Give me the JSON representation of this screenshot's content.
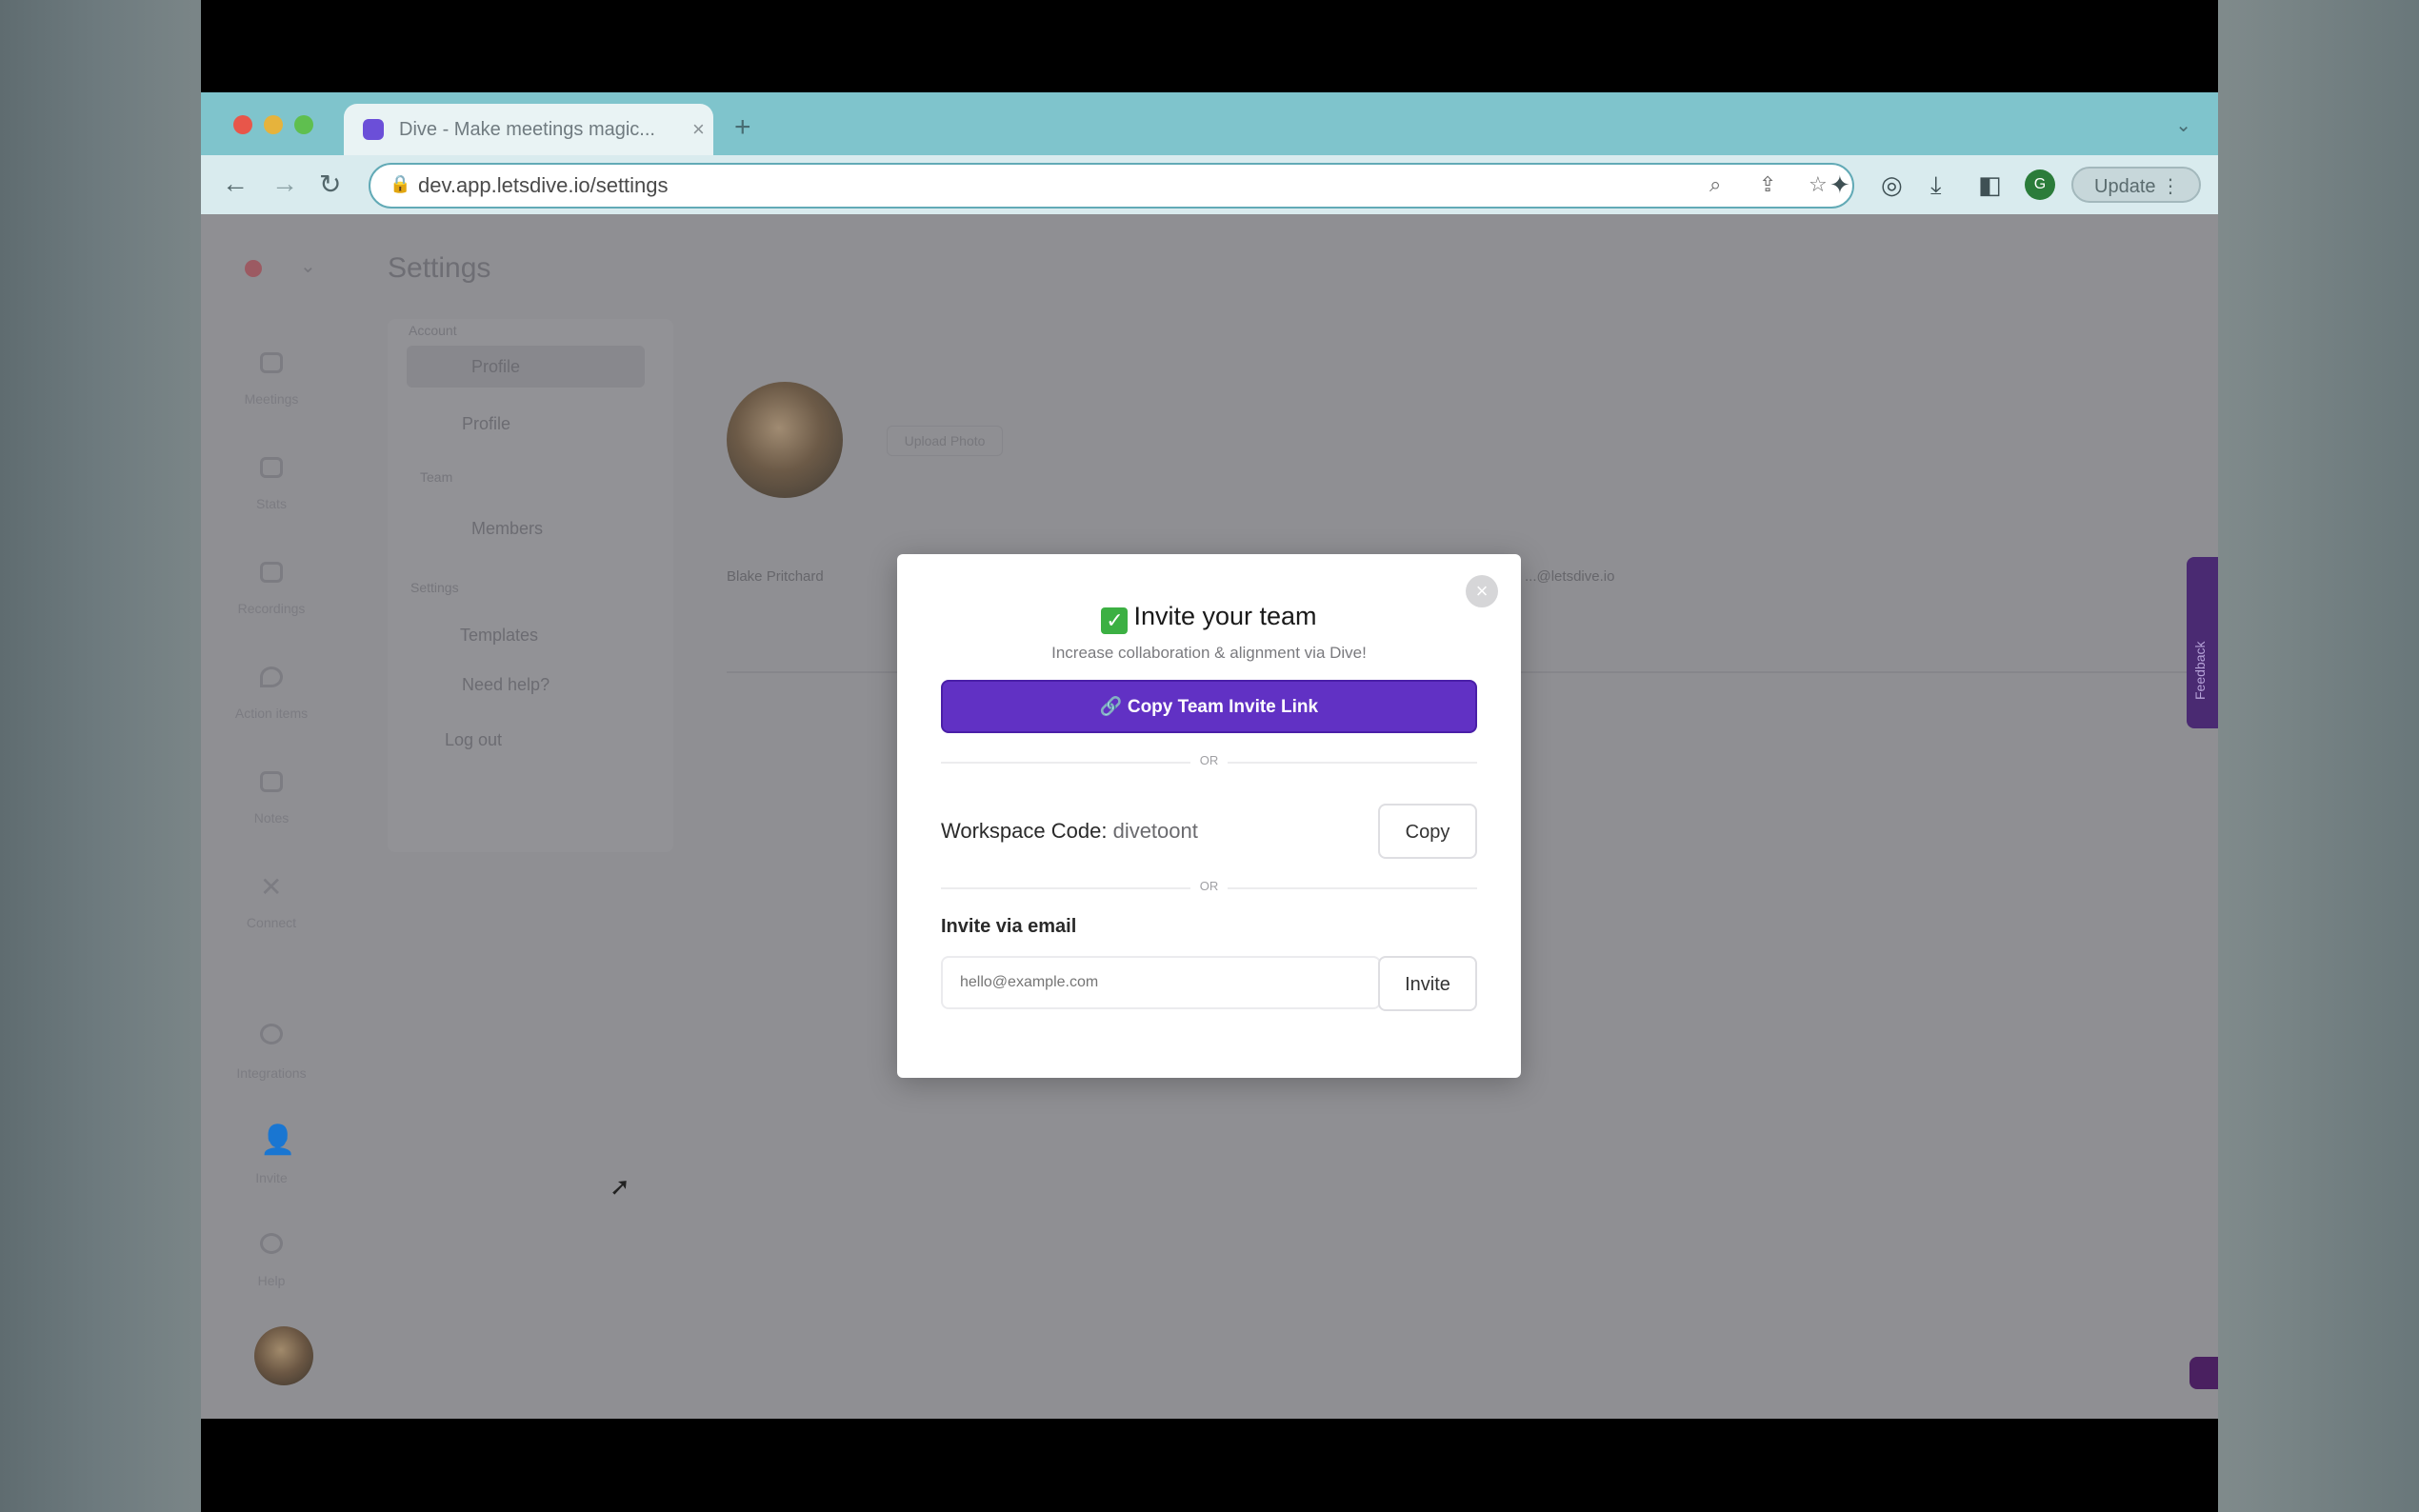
{
  "browser": {
    "tab_title": "Dive - Make meetings magic...",
    "tab_close": "×",
    "new_tab": "+",
    "url": "dev.app.letsdive.io/settings",
    "update_label": "Update",
    "profile_initial": "G"
  },
  "app": {
    "page_title": "Settings",
    "rail": [
      "Meetings",
      "Stats",
      "Recordings",
      "Action items",
      "Notes",
      "Connect",
      "Integrations",
      "Invite",
      "Help"
    ],
    "panel": {
      "section_account": "Account",
      "profile": "Profile",
      "profile2": "Profile",
      "section_team": "Team",
      "members": "Members",
      "section_settings": "Settings",
      "templates": "Templates",
      "need_help": "Need help?",
      "logout": "Log out"
    },
    "upload_label": "Upload Photo",
    "name_value": "Blake Pritchard",
    "email_value": "...@letsdive.io",
    "feedback_label": "Feedback"
  },
  "modal": {
    "close_glyph": "×",
    "check_glyph": "✓",
    "title": "Invite your team",
    "subtitle": "Increase collaboration & alignment via Dive!",
    "copy_link_label": "🔗 Copy Team Invite Link",
    "or_1": "OR",
    "workspace_label": "Workspace Code:",
    "workspace_code": "divetoont",
    "copy_label": "Copy",
    "or_2": "OR",
    "invite_email_label": "Invite via email",
    "email_placeholder": "hello@example.com",
    "invite_label": "Invite"
  },
  "colors": {
    "tabbar": "#7fc4cc",
    "primary_button": "#6131c4",
    "feedback_tab": "#4a2a72"
  }
}
